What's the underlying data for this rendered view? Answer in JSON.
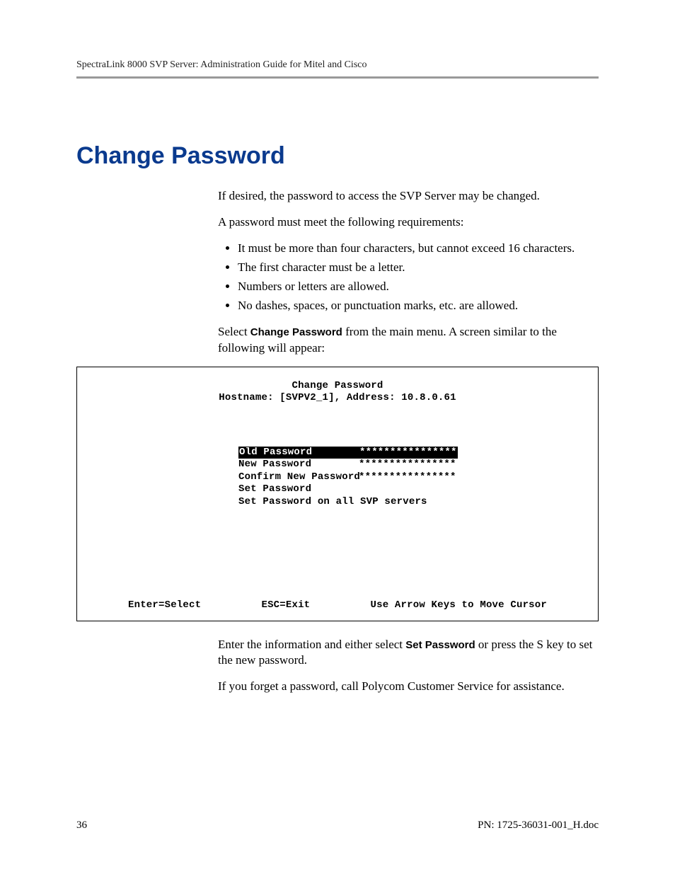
{
  "header": {
    "running_head": "SpectraLink 8000 SVP Server: Administration Guide for Mitel and Cisco"
  },
  "title": "Change Password",
  "body": {
    "p1": "If desired, the password to access the SVP Server may be changed.",
    "p2": "A password must meet the following requirements:",
    "bullets": [
      "It must be more than four characters, but cannot exceed 16 characters.",
      "The first character must be a letter.",
      "Numbers or letters are allowed.",
      "No dashes, spaces, or punctuation marks, etc. are allowed."
    ],
    "p3_pre": "Select ",
    "p3_bold": "Change Password",
    "p3_post": " from the main menu. A screen similar to the following will appear:",
    "p4_pre": "Enter the information and either select ",
    "p4_bold": "Set Password",
    "p4_post": " or press the S key to set the new password.",
    "p5": "If you forget a password, call Polycom Customer Service for assistance."
  },
  "terminal": {
    "title": "Change Password",
    "hostline": "Hostname: [SVPV2_1], Address: 10.8.0.61",
    "fields": [
      {
        "label": "Old Password",
        "value": "****************",
        "selected": true
      },
      {
        "label": "New Password",
        "value": "****************",
        "selected": false
      },
      {
        "label": "Confirm New Password",
        "value": "****************",
        "selected": false
      },
      {
        "label": "Set Password",
        "value": "",
        "selected": false
      },
      {
        "label": "Set Password on all SVP servers",
        "value": "",
        "selected": false
      }
    ],
    "footer": {
      "left": "Enter=Select",
      "mid": "ESC=Exit",
      "right": "Use Arrow Keys to Move Cursor"
    }
  },
  "footer": {
    "page_number": "36",
    "doc_id": "PN: 1725-36031-001_H.doc"
  }
}
